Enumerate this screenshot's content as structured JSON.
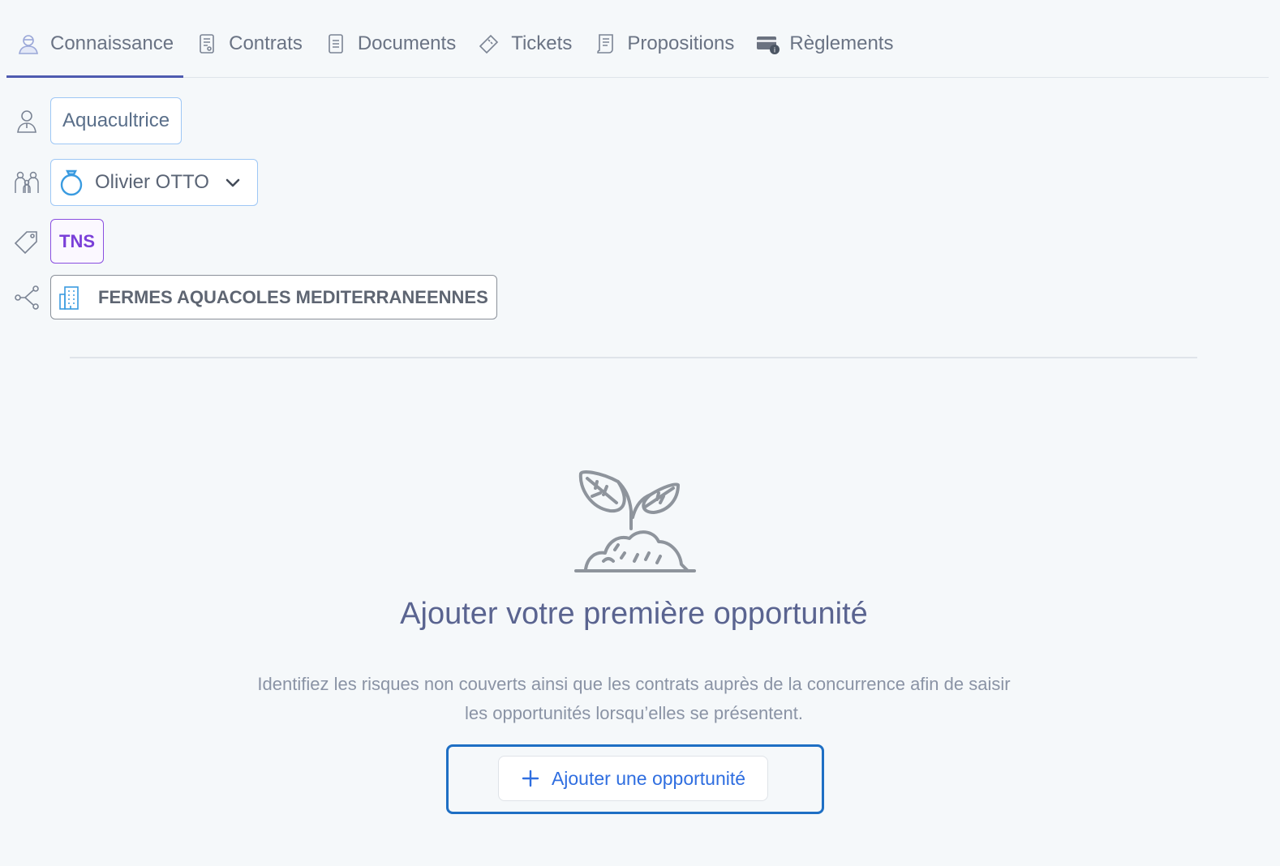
{
  "tabs": [
    {
      "label": "Connaissance",
      "icon": "user-knowledge-icon",
      "active": true
    },
    {
      "label": "Contrats",
      "icon": "contract-icon"
    },
    {
      "label": "Documents",
      "icon": "document-icon"
    },
    {
      "label": "Tickets",
      "icon": "ticket-icon"
    },
    {
      "label": "Propositions",
      "icon": "proposal-icon"
    },
    {
      "label": "Règlements",
      "icon": "payment-card-icon"
    }
  ],
  "profile": {
    "job": "Aquacultrice",
    "relation_person": "Olivier OTTO",
    "tag": "TNS",
    "company": "FERMES AQUACOLES MEDITERRANEENNES"
  },
  "empty_state": {
    "title": "Ajouter votre première opportunité",
    "description_line1": "Identifiez les risques non couverts ainsi que les contrats auprès de la concurrence afin de saisir",
    "description_line2": "les opportunités lorsqu’elles se présentent.",
    "button_label": "Ajouter une opportunité"
  },
  "colors": {
    "active_tab": "#4f5bb0",
    "tag_border": "#8a4fe0",
    "link_blue": "#2f6ee0",
    "focus_ring": "#1e6fc4"
  }
}
